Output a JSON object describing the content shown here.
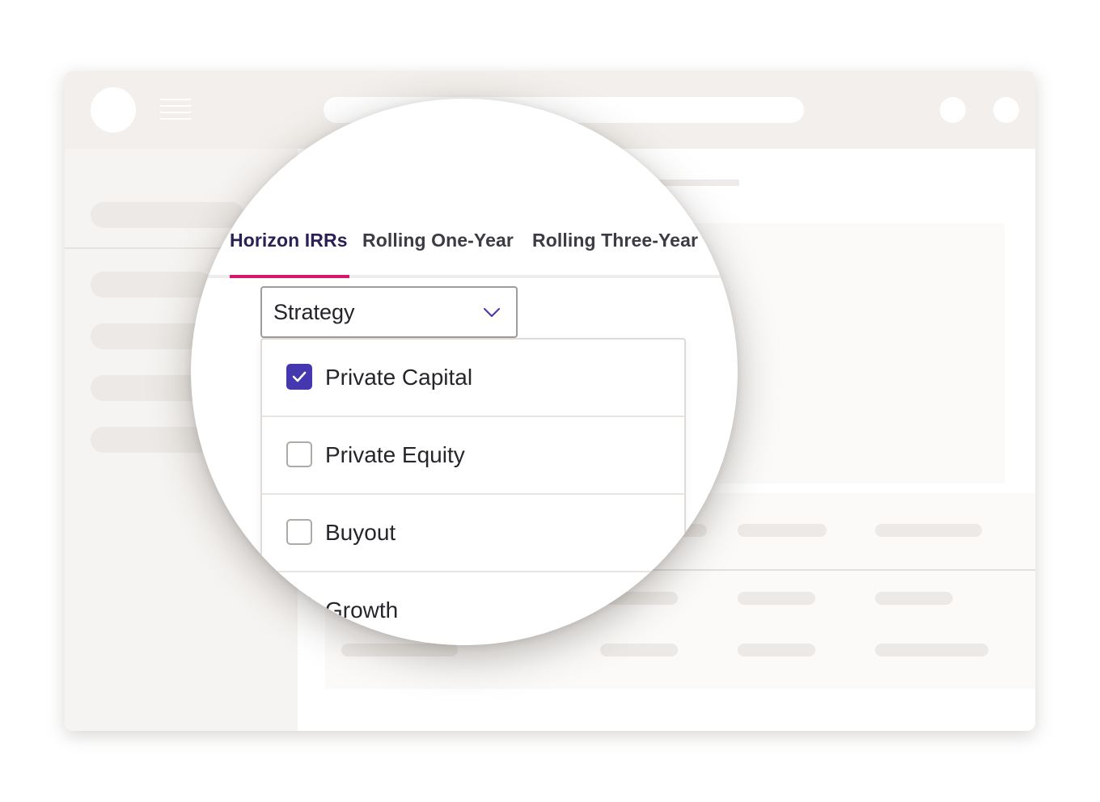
{
  "tabs": [
    {
      "label": "Horizon IRRs",
      "active": true
    },
    {
      "label": "Rolling One-Year",
      "active": false
    },
    {
      "label": "Rolling Three-Year",
      "active": false
    }
  ],
  "filter": {
    "selected_label": "Strategy",
    "icon": "chevron-down-icon"
  },
  "options": [
    {
      "label": "Private Capital",
      "checked": true
    },
    {
      "label": "Private Equity",
      "checked": false
    },
    {
      "label": "Buyout",
      "checked": false
    },
    {
      "label": "Growth",
      "checked": false
    }
  ],
  "colors": {
    "accent": "#4437b0",
    "tab_indicator": "#d6176f",
    "active_tab_text": "#2a1f56",
    "skeleton": "#ece9e6",
    "topbar": "#f2efec"
  }
}
